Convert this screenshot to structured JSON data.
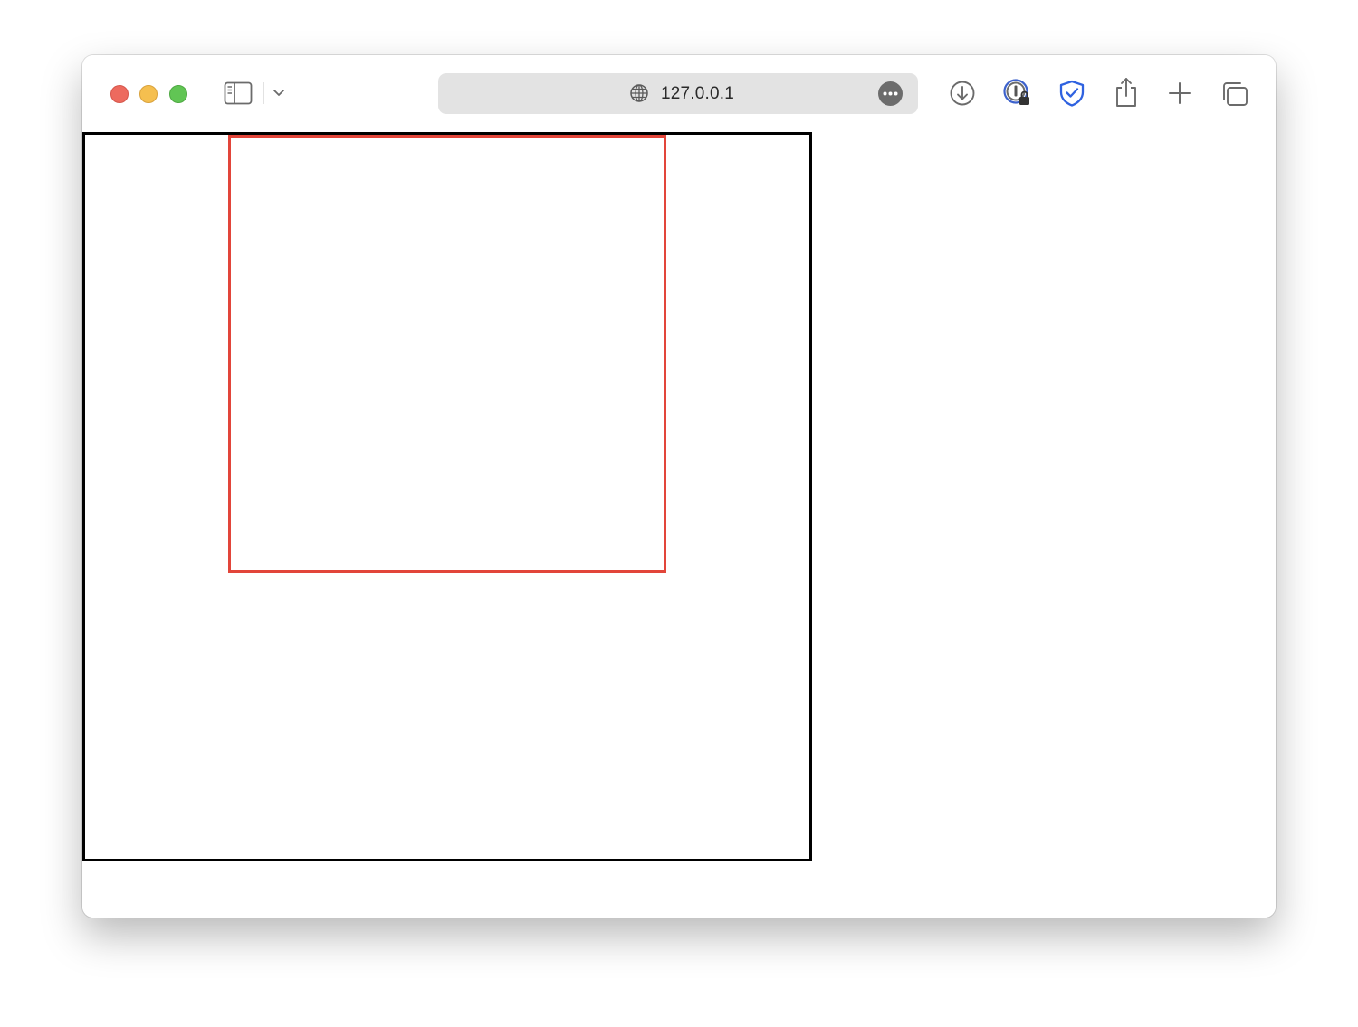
{
  "browser": {
    "address_bar": {
      "url": "127.0.0.1"
    },
    "toolbar": {
      "icons": [
        "sidebar-icon",
        "chevron-down-icon",
        "globe-icon",
        "more-icon",
        "download-icon",
        "password-manager-icon",
        "shield-check-icon",
        "share-icon",
        "plus-icon",
        "tabs-overview-icon"
      ]
    },
    "traffic_lights": {
      "close_color": "#ed6a5e",
      "minimize_color": "#f5bf4f",
      "maximize_color": "#61c554"
    }
  },
  "page": {
    "outer_box": {
      "border_color": "#000000"
    },
    "inner_box": {
      "border_color": "#e2453a"
    }
  }
}
